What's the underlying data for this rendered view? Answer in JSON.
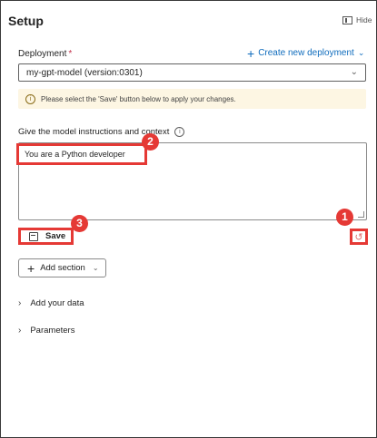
{
  "panel": {
    "title": "Setup",
    "hide_label": "Hide"
  },
  "deployment": {
    "label": "Deployment",
    "required_mark": "*",
    "create_link": "Create new deployment",
    "selected": "my-gpt-model (version:0301)"
  },
  "notice": {
    "text": "Please select the 'Save' button below to apply your changes."
  },
  "instructions": {
    "label": "Give the model instructions and context",
    "value": "You are a Python developer"
  },
  "actions": {
    "save_label": "Save"
  },
  "badges": {
    "one": "1",
    "two": "2",
    "three": "3"
  },
  "add_section": {
    "label": "Add section"
  },
  "expanders": [
    {
      "label": "Add your data"
    },
    {
      "label": "Parameters"
    }
  ],
  "icons": {
    "plus": "plus-icon",
    "chevron_down": "chevron-down-icon",
    "chevron_right": "chevron-right-icon",
    "info": "info-icon",
    "save": "save-icon",
    "reset": "reset-icon",
    "hide": "hide-panel-icon"
  },
  "colors": {
    "accent": "#0f6cbd",
    "annotation": "#e53935",
    "notice_bg": "#fdf6e3"
  }
}
